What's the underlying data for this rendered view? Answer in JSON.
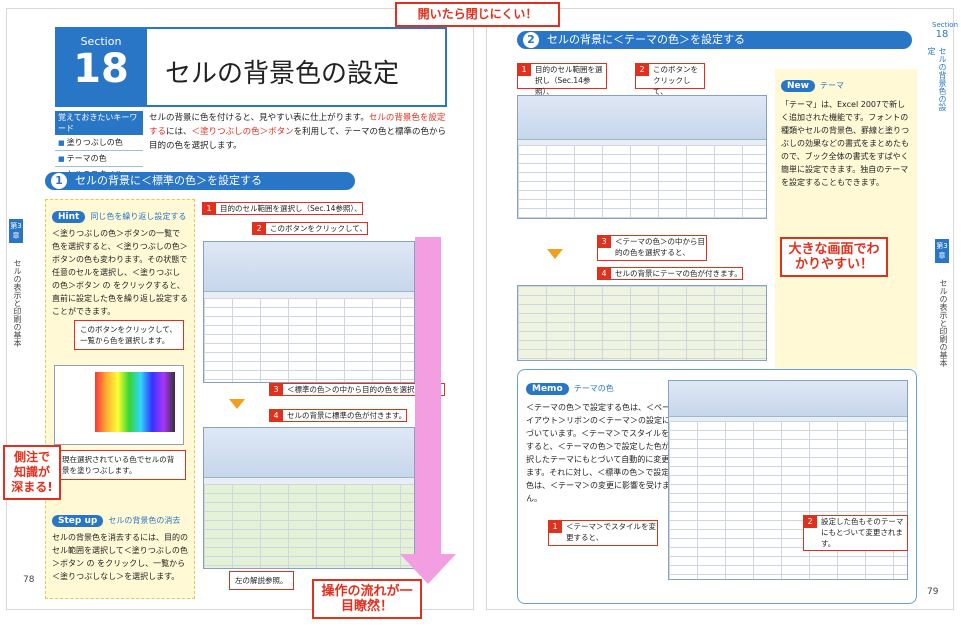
{
  "top_banner": "開いたら閉じにくい！",
  "left": {
    "section_label": "Section",
    "section_num": "18",
    "title": "セルの背景色の設定",
    "keywords_head": "覚えておきたいキーワード",
    "keywords": [
      "塗りつぶしの色",
      "テーマの色",
      "セルのスタイル"
    ],
    "intro_1": "セルの背景に色を付けると、見やすい表に仕上がります。",
    "intro_red1": "セルの背景色を設定する",
    "intro_2": "には、",
    "intro_red2": "＜塗りつぶしの色＞ボタン",
    "intro_3": "を利用して、テーマの色と標準の色から目的の色を選択します。",
    "heading_num": "1",
    "heading": "セルの背景に＜標準の色＞を設定する",
    "side_chapter": "第3章",
    "side_text": "セルの表示と印刷の基本",
    "hint_badge": "Hint",
    "hint_title": "同じ色を繰り返し設定する",
    "hint_text": "＜塗りつぶしの色＞ボタンの一覧で色を選択すると、＜塗りつぶしの色＞ボタンの色も変わります。その状態で任意のセルを選択し、＜塗りつぶしの色＞ボタン の をクリックすると、直前に設定した色を繰り返し設定することができます。",
    "hint_callout1": "このボタンをクリックして、一覧から色を選択します。",
    "hint_callout2": "現在選択されている色でセルの背景を塗りつぶします。",
    "step_badge": "Step up",
    "step_title": "セルの背景色の消去",
    "step_text": "セルの背景色を消去するには、目的のセル範囲を選択して＜塗りつぶしの色＞ボタン の をクリックし、一覧から＜塗りつぶしなし＞を選択します。",
    "promo_side": "側注で知識が深まる!",
    "steps": [
      "目的のセル範囲を選択し（Sec.14参照）、",
      "このボタンをクリックして、",
      "＜標準の色＞の中から目的の色を選択すると、",
      "セルの背景に標準の色が付きます。"
    ],
    "note": "左の解説参照。",
    "promo_bottom": "操作の流れが一目瞭然！",
    "page_no": "78"
  },
  "right": {
    "heading_num": "2",
    "heading": "セルの背景に＜テーマの色＞を設定する",
    "side_section_label": "Section",
    "side_section_num": "18",
    "side_section_text": "セルの背景色の設定",
    "side_chapter": "第3章",
    "side_text": "セルの表示と印刷の基本",
    "steps": [
      "目的のセル範囲を選択し（Sec.14参照）、",
      "このボタンをクリックして、",
      "＜テーマの色＞の中から目的の色を選択すると、",
      "セルの背景にテーマの色が付きます。"
    ],
    "new_badge": "New",
    "new_title": "テーマ",
    "new_text": "「テーマ」は、Excel 2007で新しく追加された機能です。フォントの種類やセルの背景色、罫線と塗りつぶしの効果などの書式をまとめたもので、ブック全体の書式をすばやく簡単に設定できます。独自のテーマを設定することもできます。",
    "promo": "大きな画面でわかりやすい！",
    "memo_badge": "Memo",
    "memo_title": "テーマの色",
    "memo_text": "＜テーマの色＞で設定する色は、＜ページレイアウト＞リボンの＜テーマ＞の設定にもとづいています。＜テーマ＞でスタイルを変更すると、＜テーマの色＞で設定した色が、選択したテーマにもとづいて自動的に変更されます。それに対し、＜標準の色＞で設定した色は、＜テーマ＞の変更に影響を受けません。",
    "memo_step1": "＜テーマ＞でスタイルを変更すると、",
    "memo_step2": "設定した色もそのテーマにもとづいて変更されます。",
    "page_no": "79"
  },
  "colors": {
    "accent": "#2a76c6",
    "red": "#e0301e",
    "hint_bg": "#fff9d6",
    "pink": "#f29ee0"
  }
}
